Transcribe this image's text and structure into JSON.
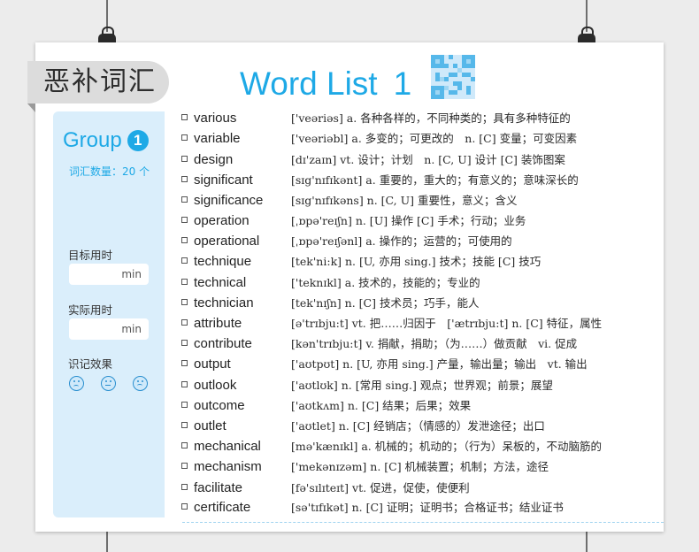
{
  "section_tag": "恶补词汇",
  "title": {
    "text": "Word List",
    "number": "1"
  },
  "sidebar": {
    "group_label": "Group",
    "group_number": "1",
    "count_label": "词汇数量：20 个",
    "target_label": "目标用时",
    "target_unit": "min",
    "actual_label": "实际用时",
    "actual_unit": "min",
    "effect_label": "识记效果"
  },
  "words": [
    {
      "word": "various",
      "def": "['veəriəs] a. 各种各样的，不同种类的；具有多种特征的"
    },
    {
      "word": "variable",
      "def": "['veəriəbl] a. 多变的；可更改的　n. [C] 变量；可变因素"
    },
    {
      "word": "design",
      "def": "[dɪ'zaɪn] vt. 设计；计划　n. [C, U] 设计 [C] 装饰图案"
    },
    {
      "word": "significant",
      "def": "[sɪg'nɪfɪkənt] a. 重要的，重大的；有意义的；意味深长的"
    },
    {
      "word": "significance",
      "def": "[sɪg'nɪfɪkəns] n. [C, U] 重要性，意义；含义"
    },
    {
      "word": "operation",
      "def": "[ˌɒpə'reɪʃn] n. [U] 操作 [C] 手术；行动；业务"
    },
    {
      "word": "operational",
      "def": "[ˌɒpə'reɪʃənl] a. 操作的；运营的；可使用的"
    },
    {
      "word": "technique",
      "def": "[tek'ni:k] n. [U, 亦用 sing.] 技术；技能 [C] 技巧"
    },
    {
      "word": "technical",
      "def": "['teknɪkl] a. 技术的，技能的；专业的"
    },
    {
      "word": "technician",
      "def": "[tek'nɪʃn] n. [C] 技术员；巧手，能人"
    },
    {
      "word": "attribute",
      "def": "[ə'trɪbju:t] vt. 把……归因于　['ætrɪbju:t] n. [C] 特征，属性"
    },
    {
      "word": "contribute",
      "def": "[kən'trɪbju:t] v. 捐献，捐助；（为……）做贡献　vi. 促成"
    },
    {
      "word": "output",
      "def": "['aʊtpʊt] n. [U, 亦用 sing.] 产量，输出量；输出　vt. 输出"
    },
    {
      "word": "outlook",
      "def": "['aʊtlʊk] n. [常用 sing.] 观点；世界观；前景；展望"
    },
    {
      "word": "outcome",
      "def": "['aʊtkʌm] n. [C] 结果；后果；效果"
    },
    {
      "word": "outlet",
      "def": "['aʊtlet] n. [C] 经销店；（情感的）发泄途径；出口"
    },
    {
      "word": "mechanical",
      "def": "[mə'kænɪkl] a. 机械的；机动的；（行为）呆板的，不动脑筋的"
    },
    {
      "word": "mechanism",
      "def": "['mekənɪzəm] n. [C] 机械装置；机制；方法，途径"
    },
    {
      "word": "facilitate",
      "def": "[fə'sɪlɪteɪt] vt. 促进，促使，使便利"
    },
    {
      "word": "certificate",
      "def": "[sə'tɪfɪkət] n. [C] 证明；证明书；合格证书；结业证书"
    }
  ],
  "colors": {
    "accent": "#1ea9e6",
    "panel": "#daeefb",
    "tag": "#dcdcdc"
  },
  "icons": [
    "qr-code-icon",
    "sad-face-icon",
    "neutral-face-icon",
    "upset-face-icon"
  ]
}
